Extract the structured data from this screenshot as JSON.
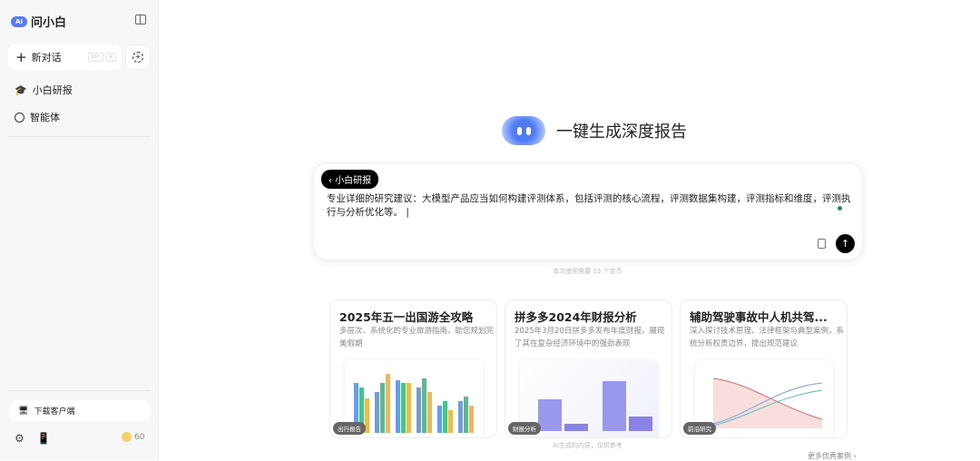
{
  "sidebar": {
    "app_name": "问小白",
    "logo_badge": "AI",
    "new_chat": "新对话",
    "shortcut": [
      "Ctrl",
      "K"
    ],
    "items": [
      {
        "label": "小白研报",
        "icon": "graduation-cap-icon"
      },
      {
        "label": "智能体",
        "icon": "robot-icon"
      }
    ],
    "download": "下载客户端",
    "coins": "60"
  },
  "main": {
    "hero_title": "一键生成深度报告",
    "mode_pill": "小白研报",
    "prompt": "专业详细的研究建议：大模型产品应当如何构建评测体系，包括评测的核心流程，评测数据集构建，评测指标和维度，评测执行与分析优化等。",
    "cost_hint": "本次使用需要 15 个金币",
    "cards": [
      {
        "title": "2025年五一出国游全攻略",
        "desc": "多层次、系统化的专业旅游指南，助您规划完美假期",
        "tag": "出行报告"
      },
      {
        "title": "拼多多2024年财报分析",
        "desc": "2025年3月20日拼多多发布年度财报，展现了其在复杂经济环境中的强劲表现",
        "tag": "财报分析"
      },
      {
        "title": "辅助驾驶事故中人机共驾...",
        "desc": "深入探讨技术原理、法律框架与典型案例，系统分析权责边界，提出规范建议",
        "tag": "前沿研究"
      }
    ],
    "disclaimer": "AI生成的内容，仅供参考",
    "more": "更多优秀案例 ›"
  },
  "colors": {
    "accent": "#5b7cf0",
    "send": "#000000",
    "status_dot": "#1c8f60"
  }
}
